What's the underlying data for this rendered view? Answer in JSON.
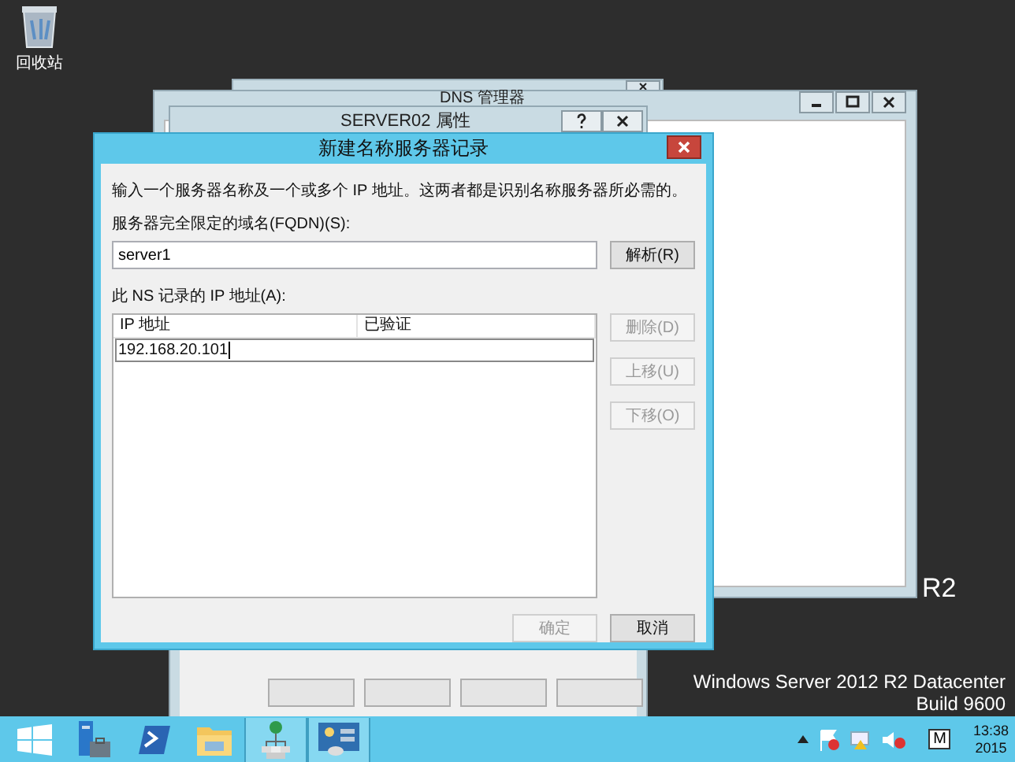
{
  "desktop": {
    "icons": [
      {
        "kind": "recycle-bin",
        "label": "回收站"
      }
    ],
    "watermark_partial": "R2",
    "watermark": [
      "Windows Server 2012 R2 Datacenter",
      "Build 9600"
    ]
  },
  "background_windows": [
    {
      "kind": "blank"
    },
    {
      "kind": "dns",
      "title": "DNS 管理器"
    },
    {
      "kind": "properties",
      "title": "SERVER02 属性"
    }
  ],
  "dialog": {
    "title": "新建名称服务器记录",
    "description": "输入一个服务器名称及一个或多个 IP 地址。这两者都是识别名称服务器所必需的。",
    "fqdn_label": "服务器完全限定的域名(FQDN)(S):",
    "fqdn_value": "server1",
    "resolve_button": "解析(R)",
    "ip_label": "此 NS 记录的 IP 地址(A):",
    "columns": [
      "IP 地址",
      "已验证"
    ],
    "ip_entry": "192.168.20.101",
    "side_buttons": [
      {
        "label": "删除(D)",
        "disabled": true
      },
      {
        "label": "上移(U)",
        "disabled": true
      },
      {
        "label": "下移(O)",
        "disabled": true
      }
    ],
    "buttons": [
      {
        "label": "确定",
        "disabled": true
      },
      {
        "label": "取消",
        "disabled": false
      }
    ]
  },
  "taskbar": {
    "apps": [
      {
        "kind": "start",
        "running": false
      },
      {
        "kind": "server-manager",
        "running": false
      },
      {
        "kind": "powershell",
        "running": false
      },
      {
        "kind": "explorer",
        "running": false
      },
      {
        "kind": "network",
        "running": true
      },
      {
        "kind": "dns",
        "running": true
      }
    ],
    "input_indicator": "M",
    "clock": {
      "time": "13:38",
      "date": "2015"
    }
  }
}
